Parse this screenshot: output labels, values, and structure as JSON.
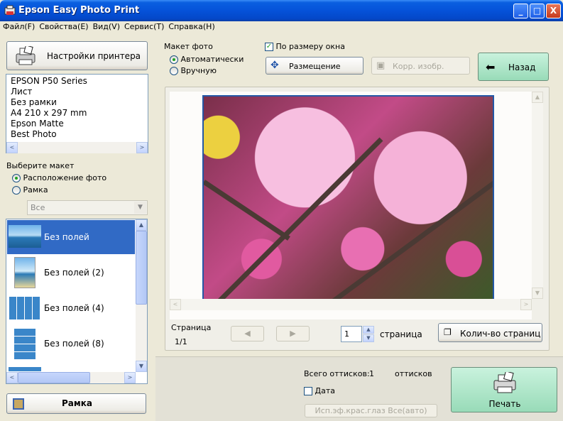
{
  "window": {
    "title": "Epson Easy Photo Print",
    "min": "_",
    "max": "□",
    "close": "X"
  },
  "menu": [
    "Файл(F)",
    "Свойства(E)",
    "Вид(V)",
    "Сервис(T)",
    "Справка(H)"
  ],
  "printer_settings": {
    "button_label": "Настройки принтера",
    "info": [
      "EPSON P50 Series",
      "Лист",
      "Без рамки",
      "A4 210 x 297 mm",
      "Epson Matte",
      "Best Photo"
    ]
  },
  "layout_select": {
    "heading": "Выберите макет",
    "options": [
      "Расположение фото",
      "Рамка"
    ],
    "selected": "Расположение фото",
    "filter_value": "Все",
    "items": [
      "Без полей",
      "Без полей (2)",
      "Без полей (4)",
      "Без полей (8)"
    ],
    "selected_item": "Без полей"
  },
  "frame_button": "Рамка",
  "photo_layout": {
    "heading": "Макет фото",
    "options": [
      "Автоматически",
      "Вручную"
    ],
    "selected": "Автоматически"
  },
  "fit_window": {
    "label": "По размеру окна",
    "checked": true
  },
  "placement_button": "Размещение",
  "correct_button": "Корр. изобр.",
  "back_button": "Назад",
  "page": {
    "label": "Страница",
    "value": "1/1",
    "number": "1",
    "suffix": "страница"
  },
  "page_count_button": "Колич-во страниц",
  "total": {
    "label": "Всего оттисков:",
    "value": "1",
    "unit": "оттисков"
  },
  "date": {
    "label": "Дата",
    "checked": false
  },
  "red_eye_button": "Исп.эф.крас.глаз Все(авто)",
  "print_button": "Печать",
  "colors": {
    "accent": "#316ac5",
    "green_btn": "#a8e3c4",
    "title": "#0552d9"
  }
}
